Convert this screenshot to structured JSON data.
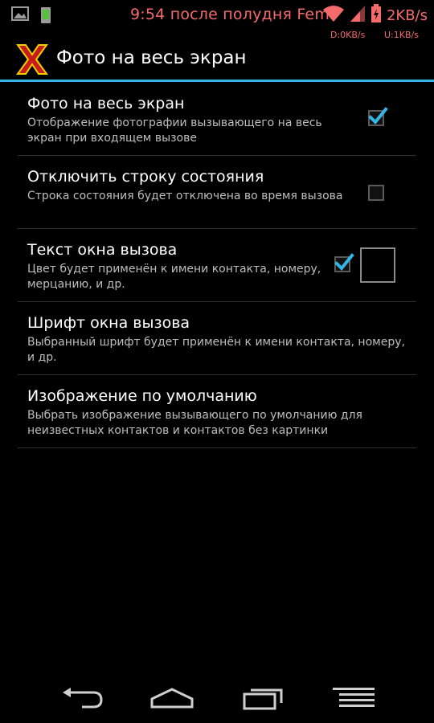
{
  "status_bar": {
    "time": "9:54 после полудня Femi",
    "net_speed": "2KB/s",
    "download": "D:0KB/s",
    "upload": "U:1KB/s",
    "accent_color": "#f56a6a",
    "icons": [
      "image-icon",
      "phone-battery-icon",
      "wifi-icon",
      "signal-icon",
      "battery-charging-icon"
    ]
  },
  "action_bar": {
    "title": "Фото на весь экран",
    "logo": "red-x-logo",
    "underline_color": "#33b5e5"
  },
  "preferences": [
    {
      "title": "Фото на весь экран",
      "summary": "Отображение фотографии вызывающего на весь экран при входящем вызове",
      "checked": true
    },
    {
      "title": "Отключить строку состояния",
      "summary": "Строка состояния будет отключена во время вызова",
      "checked": false
    },
    {
      "title": "Текст окна вызова",
      "summary": "Цвет будет применён к имени контакта, номеру, мерцанию, и др.",
      "checked": true,
      "color_value": "#000000"
    },
    {
      "title": "Шрифт окна вызова",
      "summary": "Выбранный шрифт будет применён к имени контакта, номеру, и др."
    },
    {
      "title": "Изображение по умолчанию",
      "summary": "Выбрать изображение вызывающего по умолчанию для неизвестных контактов и контактов без картинки"
    }
  ],
  "nav_bar": {
    "icons": [
      "back-icon",
      "home-icon",
      "recent-apps-icon",
      "menu-icon"
    ]
  }
}
